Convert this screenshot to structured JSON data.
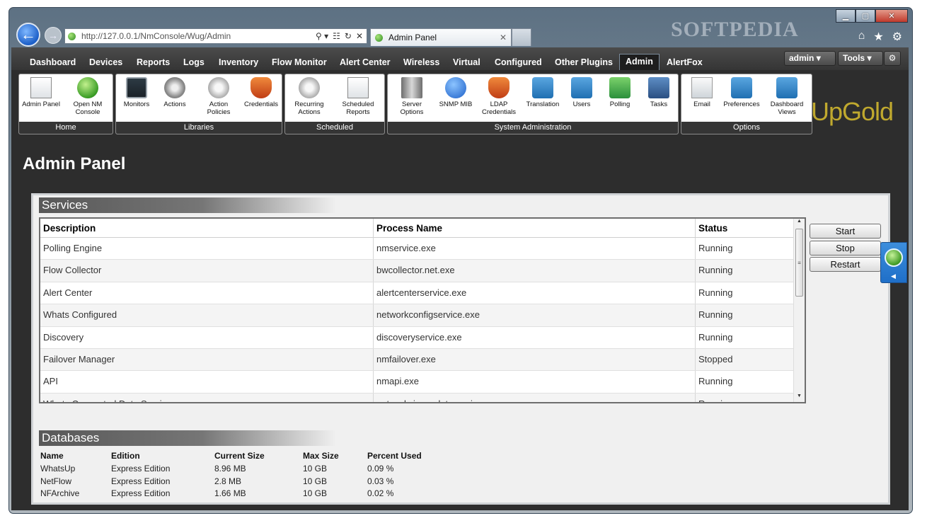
{
  "browser": {
    "url": "http://127.0.0.1/NmConsole/Wug/Admin",
    "tab_title": "Admin Panel",
    "watermark": "SOFTPEDIA",
    "address_icons": [
      "magnifier-icon",
      "compat-icon",
      "refresh-icon",
      "stop-icon"
    ],
    "tool_icons": [
      "home-icon",
      "favorites-icon",
      "gear-icon"
    ]
  },
  "nav": {
    "items": [
      "Dashboard",
      "Devices",
      "Reports",
      "Logs",
      "Inventory",
      "Flow Monitor",
      "Alert Center",
      "Wireless",
      "Virtual",
      "Configured",
      "Other Plugins",
      "Admin",
      "AlertFox"
    ],
    "active": "Admin",
    "user": "admin",
    "tools": "Tools"
  },
  "ribbon": {
    "home": {
      "caption": "Home",
      "buttons": [
        "Admin Panel",
        "Open NM Console"
      ]
    },
    "libraries": {
      "caption": "Libraries",
      "buttons": [
        "Monitors",
        "Actions",
        "Action Policies",
        "Credentials"
      ]
    },
    "scheduled": {
      "caption": "Scheduled",
      "buttons": [
        "Recurring Actions",
        "Scheduled Reports"
      ]
    },
    "sysadmin": {
      "caption": "System Administration",
      "buttons": [
        "Server Options",
        "SNMP MIB",
        "LDAP Credentials",
        "Translation",
        "Users",
        "Polling",
        "Tasks"
      ]
    },
    "options": {
      "caption": "Options",
      "buttons": [
        "Email",
        "Preferences",
        "Dashboard Views"
      ]
    },
    "logo_text": "UpGold"
  },
  "page": {
    "title": "Admin Panel"
  },
  "services": {
    "title": "Services",
    "columns": [
      "Description",
      "Process Name",
      "Status"
    ],
    "rows": [
      [
        "Polling Engine",
        "nmservice.exe",
        "Running"
      ],
      [
        "Flow Collector",
        "bwcollector.net.exe",
        "Running"
      ],
      [
        "Alert Center",
        "alertcenterservice.exe",
        "Running"
      ],
      [
        "Whats Configured",
        "networkconfigservice.exe",
        "Running"
      ],
      [
        "Discovery",
        "discoveryservice.exe",
        "Running"
      ],
      [
        "Failover Manager",
        "nmfailover.exe",
        "Stopped"
      ],
      [
        "API",
        "nmapi.exe",
        "Running"
      ],
      [
        "Whats Connected Data Service",
        "networkviewerdataservice.exe",
        "Running"
      ]
    ],
    "buttons": {
      "start": "Start",
      "stop": "Stop",
      "restart": "Restart"
    }
  },
  "databases": {
    "title": "Databases",
    "columns": [
      "Name",
      "Edition",
      "Current Size",
      "Max Size",
      "Percent Used"
    ],
    "rows": [
      [
        "WhatsUp",
        "Express Edition",
        "8.96 MB",
        "10 GB",
        "0.09 %"
      ],
      [
        "NetFlow",
        "Express Edition",
        "2.8 MB",
        "10 GB",
        "0.03 %"
      ],
      [
        "NFArchive",
        "Express Edition",
        "1.66 MB",
        "10 GB",
        "0.02 %"
      ]
    ]
  }
}
